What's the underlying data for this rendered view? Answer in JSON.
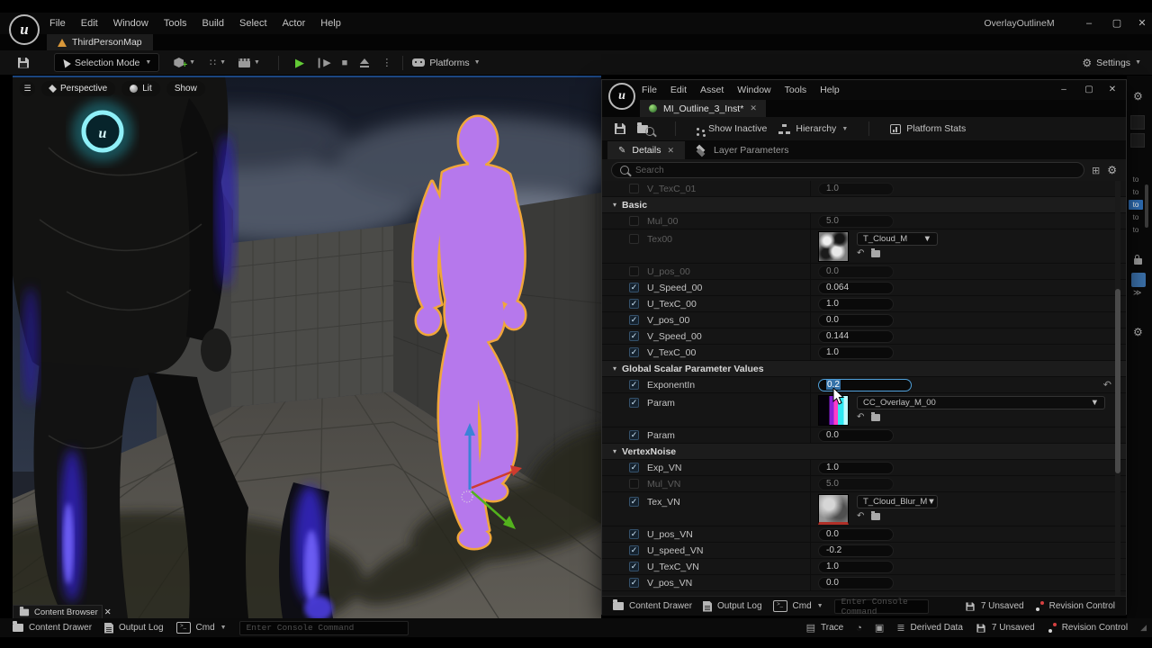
{
  "window": {
    "title": "OverlayOutlineM"
  },
  "main": {
    "menu": [
      "File",
      "Edit",
      "Window",
      "Tools",
      "Build",
      "Select",
      "Actor",
      "Help"
    ]
  },
  "map_tab": {
    "label": "ThirdPersonMap"
  },
  "toolbar": {
    "selection_mode": "Selection Mode",
    "platforms": "Platforms",
    "settings": "Settings"
  },
  "viewport_overlay": {
    "perspective": "Perspective",
    "lit": "Lit",
    "show": "Show"
  },
  "mat": {
    "menu": [
      "File",
      "Edit",
      "Asset",
      "Window",
      "Tools",
      "Help"
    ],
    "tab_label": "MI_Outline_3_Inst*",
    "toolbar": {
      "show_inactive": "Show Inactive",
      "hierarchy": "Hierarchy",
      "platform_stats": "Platform Stats"
    },
    "doc_tabs": {
      "details": "Details",
      "layer_parameters": "Layer Parameters"
    },
    "search_placeholder": "Search",
    "rows": [
      {
        "kind": "param",
        "name": "V_TexC_01",
        "checked": false,
        "dimmed": true,
        "type": "scalar",
        "value": "1.0"
      },
      {
        "kind": "category",
        "name": "Basic"
      },
      {
        "kind": "param",
        "name": "Mul_00",
        "checked": false,
        "dimmed": true,
        "type": "scalar",
        "value": "5.0"
      },
      {
        "kind": "param",
        "name": "Tex00",
        "checked": false,
        "dimmed": true,
        "type": "texture",
        "asset": "T_Cloud_M",
        "thumb": "cloud"
      },
      {
        "kind": "param",
        "name": "U_pos_00",
        "checked": false,
        "dimmed": true,
        "type": "scalar",
        "value": "0.0"
      },
      {
        "kind": "param",
        "name": "U_Speed_00",
        "checked": true,
        "type": "scalar",
        "value": "0.064"
      },
      {
        "kind": "param",
        "name": "U_TexC_00",
        "checked": true,
        "type": "scalar",
        "value": "1.0"
      },
      {
        "kind": "param",
        "name": "V_pos_00",
        "checked": true,
        "type": "scalar",
        "value": "0.0"
      },
      {
        "kind": "param",
        "name": "V_Speed_00",
        "checked": true,
        "type": "scalar",
        "value": "0.144"
      },
      {
        "kind": "param",
        "name": "V_TexC_00",
        "checked": true,
        "type": "scalar",
        "value": "1.0"
      },
      {
        "kind": "category",
        "name": "Global Scalar Parameter Values"
      },
      {
        "kind": "param",
        "name": "ExponentIn",
        "checked": true,
        "type": "scalar",
        "value": "0.2",
        "selected": true,
        "reset": true
      },
      {
        "kind": "param",
        "name": "Param",
        "checked": true,
        "type": "curve",
        "asset": "CC_Overlay_M_00",
        "thumb": "curve"
      },
      {
        "kind": "param",
        "name": "Param",
        "checked": true,
        "type": "scalar",
        "value": "0.0"
      },
      {
        "kind": "category",
        "name": "VertexNoise"
      },
      {
        "kind": "param",
        "name": "Exp_VN",
        "checked": true,
        "type": "scalar",
        "value": "1.0"
      },
      {
        "kind": "param",
        "name": "Mul_VN",
        "checked": false,
        "dimmed": true,
        "type": "scalar",
        "value": "5.0"
      },
      {
        "kind": "param",
        "name": "Tex_VN",
        "checked": true,
        "type": "texture",
        "asset": "T_Cloud_Blur_M",
        "thumb": "blur"
      },
      {
        "kind": "param",
        "name": "U_pos_VN",
        "checked": true,
        "type": "scalar",
        "value": "0.0"
      },
      {
        "kind": "param",
        "name": "U_speed_VN",
        "checked": true,
        "type": "scalar",
        "value": "-0.2"
      },
      {
        "kind": "param",
        "name": "U_TexC_VN",
        "checked": true,
        "type": "scalar",
        "value": "1.0"
      },
      {
        "kind": "param",
        "name": "V_pos_VN",
        "checked": true,
        "type": "scalar",
        "value": "0.0"
      }
    ],
    "bottom": {
      "content_drawer": "Content Drawer",
      "output_log": "Output Log",
      "cmd": "Cmd",
      "console_placeholder": "Enter Console Command",
      "unsaved": "7 Unsaved",
      "revision": "Revision Control"
    }
  },
  "status": {
    "content_browser": "Content Browser",
    "content_drawer": "Content Drawer",
    "output_log": "Output Log",
    "cmd": "Cmd",
    "console_placeholder": "Enter Console Command",
    "trace": "Trace",
    "derived_data": "Derived Data",
    "unsaved": "7 Unsaved",
    "revision": "Revision Control"
  },
  "right_strip": {
    "items": [
      "to",
      "to",
      "to",
      "to",
      "to"
    ],
    "selected_index": 2
  },
  "colors": {
    "outline_orange": "#f0a63a",
    "camo_purple": "#b678ec",
    "camo_pink": "#ff5fd6",
    "camo_cyan": "#c6f8f0",
    "check_blue": "#cfe8fa",
    "selection_blue": "#3572a8",
    "play_green": "#63cb36",
    "warning_orange": "#d9983a",
    "revision_red": "#d54040",
    "chest_glow_cyan": "#8ff0f8"
  }
}
